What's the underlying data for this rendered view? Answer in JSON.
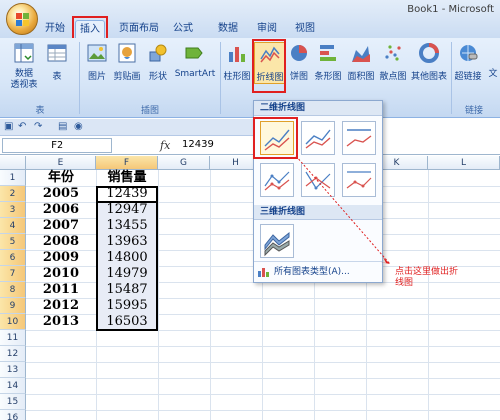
{
  "window": {
    "title": "Book1 - Microsoft"
  },
  "tabs": [
    {
      "label": "开始"
    },
    {
      "label": "插入"
    },
    {
      "label": "页面布局"
    },
    {
      "label": "公式"
    },
    {
      "label": "数据"
    },
    {
      "label": "审阅"
    },
    {
      "label": "视图"
    }
  ],
  "ribbon": {
    "buttons": {
      "pivot_table": "数据\n透视表",
      "table": "表",
      "picture": "图片",
      "clip_art": "剪贴画",
      "shapes": "形状",
      "smartart": "SmartArt",
      "column_chart": "柱形图",
      "line_chart": "折线图",
      "pie_chart": "饼图",
      "bar_chart": "条形图",
      "area_chart": "面积图",
      "scatter_chart": "散点图",
      "other_charts": "其他图表",
      "hyperlink": "超链接",
      "text": "文"
    },
    "groups": {
      "tables": "表",
      "illustrations": "插图",
      "links": "链接"
    }
  },
  "formula_bar": {
    "name_box": "F2",
    "fx": "fx",
    "value": "12439"
  },
  "grid": {
    "columns": [
      "E",
      "F",
      "G",
      "H",
      "I",
      "J",
      "K",
      "L"
    ],
    "rows": [
      "1",
      "2",
      "3",
      "4",
      "5",
      "6",
      "7",
      "8",
      "9",
      "10",
      "11",
      "12",
      "13",
      "14",
      "15",
      "16"
    ],
    "header_year": "年份",
    "header_sales": "销售量",
    "data": [
      {
        "year": "2005",
        "sales": "12439"
      },
      {
        "year": "2006",
        "sales": "12947"
      },
      {
        "year": "2007",
        "sales": "13455"
      },
      {
        "year": "2008",
        "sales": "13963"
      },
      {
        "year": "2009",
        "sales": "14800"
      },
      {
        "year": "2010",
        "sales": "14979"
      },
      {
        "year": "2011",
        "sales": "15487"
      },
      {
        "year": "2012",
        "sales": "15995"
      },
      {
        "year": "2013",
        "sales": "16503"
      }
    ]
  },
  "dropdown": {
    "section_2d": "二维折线图",
    "section_3d": "三维折线图",
    "all_charts": "所有图表类型(A)..."
  },
  "annotation": "点击这里做出折线图",
  "colors": {
    "highlight_red": "#e02020",
    "ribbon_bg": "#d6e5f7",
    "accent_text": "#15428b"
  }
}
